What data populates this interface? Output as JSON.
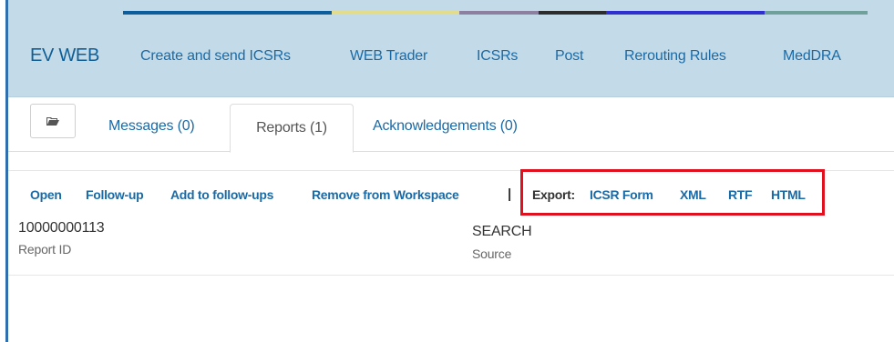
{
  "header": {
    "brand": "EV WEB",
    "nav": [
      {
        "label": "Create and send ICSRs"
      },
      {
        "label": "WEB Trader"
      },
      {
        "label": "ICSRs"
      },
      {
        "label": "Post"
      },
      {
        "label": "Rerouting Rules"
      },
      {
        "label": "MedDRA"
      }
    ],
    "strip_colors": [
      "#0c5d9b",
      "#e2dc8c",
      "#8c7fa0",
      "#2c2c2c",
      "#2f2fd0",
      "#6fa09a"
    ]
  },
  "tabs": {
    "folder_icon": "folder-open-icon",
    "messages": "Messages (0)",
    "reports": "Reports (1)",
    "acknowledgements": "Acknowledgements (0)"
  },
  "actions": {
    "open": "Open",
    "follow_up": "Follow-up",
    "add_to_follow_ups": "Add to follow-ups",
    "remove_from_workspace": "Remove from Workspace",
    "separator": "|",
    "export_label": "Export:",
    "export_options": [
      "ICSR Form",
      "XML",
      "RTF",
      "HTML"
    ]
  },
  "report": {
    "report_id_value": "10000000113",
    "report_id_label": "Report ID",
    "source_value": "SEARCH",
    "source_label": "Source"
  },
  "colors": {
    "header_bg": "#c3dbe9",
    "link": "#1a6aa6",
    "brand": "#0f5e96",
    "highlight": "#e0101e",
    "left_edge": "#2f6fad"
  }
}
